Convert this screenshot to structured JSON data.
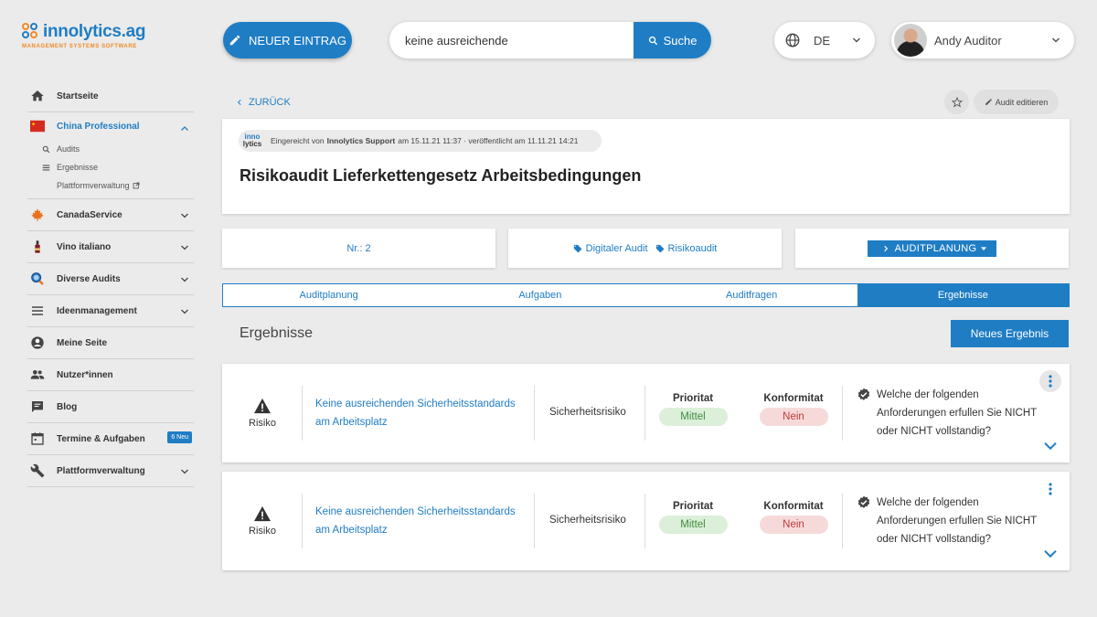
{
  "brand": {
    "name": "innolytics.ag",
    "tagline": "MANAGEMENT SYSTEMS SOFTWARE"
  },
  "topbar": {
    "new_entry_label": "NEUER EINTRAG",
    "search_value": "keine ausreichende",
    "search_button_label": "Suche",
    "language": "DE",
    "user_name": "Andy Auditor"
  },
  "sidebar": {
    "items": [
      {
        "label": "Startseite",
        "icon": "home-icon"
      },
      {
        "label": "China Professional",
        "icon": "china-flag-icon",
        "active": true,
        "sub": [
          {
            "label": "Audits",
            "icon": "search-icon"
          },
          {
            "label": "Ergebnisse",
            "icon": "list-icon"
          },
          {
            "label": "Plattformverwaltung",
            "icon": "external-link-icon"
          }
        ]
      },
      {
        "label": "CanadaService",
        "icon": "maple-leaf-icon"
      },
      {
        "label": "Vino italiano",
        "icon": "wine-bottle-icon"
      },
      {
        "label": "Diverse Audits",
        "icon": "audit-magnifier-icon"
      },
      {
        "label": "Ideenmanagement",
        "icon": "menu-icon"
      },
      {
        "label": "Meine Seite",
        "icon": "account-circle-icon"
      },
      {
        "label": "Nutzer*innen",
        "icon": "people-icon"
      },
      {
        "label": "Blog",
        "icon": "chat-icon"
      },
      {
        "label": "Termine & Aufgaben",
        "icon": "calendar-icon",
        "badge": "6 Neu"
      },
      {
        "label": "Plattformverwaltung",
        "icon": "wrench-icon"
      }
    ]
  },
  "page": {
    "back_label": "ZURÜCK",
    "edit_label": "Audit editieren",
    "meta": {
      "logo_top": "inno",
      "logo_bottom": "lytics",
      "submitted_prefix": "Eingereicht von",
      "submitted_by": "Innolytics Support",
      "submitted_suffix": "am 15.11.21 11:37 · veröffentlicht am 11.11.21 14:21"
    },
    "title": "Risikoaudit Lieferkettengesetz Arbeitsbedingungen",
    "number": "Nr.: 2",
    "tags": [
      "Digitaler Audit",
      "Risikoaudit"
    ],
    "phase_label": "AUDITPLANUNG"
  },
  "tabs": [
    {
      "label": "Auditplanung"
    },
    {
      "label": "Aufgaben"
    },
    {
      "label": "Auditfragen"
    },
    {
      "label": "Ergebnisse",
      "active": true
    }
  ],
  "results": {
    "title": "Ergebnisse",
    "new_button_label": "Neues Ergebnis",
    "items": [
      {
        "risk_label": "Risiko",
        "title": "Keine ausreichenden Sicherheitsstandards am Arbeitsplatz",
        "category": "Sicherheitsrisiko",
        "priority_label": "Prioritat",
        "priority_value": "Mittel",
        "conformity_label": "Konformitat",
        "conformity_value": "Nein",
        "question": "Welche der folgenden Anforderungen erfullen Sie NICHT oder NICHT vollstandig?"
      },
      {
        "risk_label": "Risiko",
        "title": "Keine ausreichenden Sicherheitsstandards am Arbeitsplatz",
        "category": "Sicherheitsrisiko",
        "priority_label": "Prioritat",
        "priority_value": "Mittel",
        "conformity_label": "Konformitat",
        "conformity_value": "Nein",
        "question": "Welche der folgenden Anforderungen erfullen Sie NICHT oder NICHT vollstandig?"
      }
    ]
  },
  "colors": {
    "accent": "#1f7dc4",
    "brand_orange": "#f08a24",
    "success_bg": "#dcefd9",
    "danger_bg": "#f6dada"
  }
}
